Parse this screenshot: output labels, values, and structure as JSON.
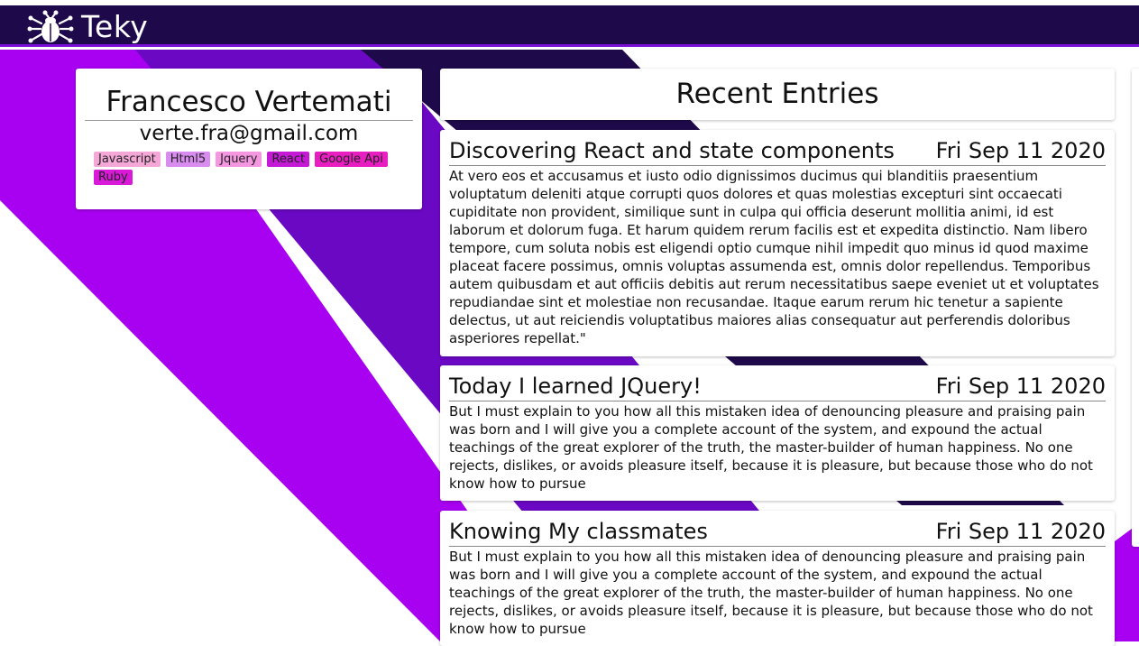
{
  "app": {
    "name": "Teky",
    "logo_icon": "bug-icon"
  },
  "profile": {
    "name": "Francesco Vertemati",
    "email": "verte.fra@gmail.com",
    "tags": [
      {
        "label": "Javascript",
        "color": "#f5a7d8"
      },
      {
        "label": "Html5",
        "color": "#d98cf0"
      },
      {
        "label": "Jquery",
        "color": "#f596e0"
      },
      {
        "label": "React",
        "color": "#c41ad6"
      },
      {
        "label": "Google Api",
        "color": "#e81ec0"
      },
      {
        "label": "Ruby",
        "color": "#d81ad8"
      }
    ]
  },
  "main": {
    "title": "Recent Entries",
    "entries": [
      {
        "title": "Discovering React and state components",
        "date": "Fri Sep 11 2020",
        "body": "At vero eos et accusamus et iusto odio dignissimos ducimus qui blanditiis praesentium voluptatum deleniti atque corrupti quos dolores et quas molestias excepturi sint occaecati cupiditate non provident, similique sunt in culpa qui officia deserunt mollitia animi, id est laborum et dolorum fuga. Et harum quidem rerum facilis est et expedita distinctio. Nam libero tempore, cum soluta nobis est eligendi optio cumque nihil impedit quo minus id quod maxime placeat facere possimus, omnis voluptas assumenda est, omnis dolor repellendus. Temporibus autem quibusdam et aut officiis debitis aut rerum necessitatibus saepe eveniet ut et voluptates repudiandae sint et molestiae non recusandae. Itaque earum rerum hic tenetur a sapiente delectus, ut aut reiciendis voluptatibus maiores alias consequatur aut perferendis doloribus asperiores repellat.\""
      },
      {
        "title": "Today I learned JQuery!",
        "date": "Fri Sep 11 2020",
        "body": "But I must explain to you how all this mistaken idea of denouncing pleasure and praising pain was born and I will give you a complete account of the system, and expound the actual teachings of the great explorer of the truth, the master-builder of human happiness. No one rejects, dislikes, or avoids pleasure itself, because it is pleasure, but because those who do not know how to pursue"
      },
      {
        "title": "Knowing My classmates",
        "date": "Fri Sep 11 2020",
        "body": "But I must explain to you how all this mistaken idea of denouncing pleasure and praising pain was born and I will give you a complete account of the system, and expound the actual teachings of the great explorer of the truth, the master-builder of human happiness. No one rejects, dislikes, or avoids pleasure itself, because it is pleasure, but because those who do not know how to pursue"
      }
    ]
  },
  "colors": {
    "topbar": "#1e0a4a",
    "accent": "#7a10d6",
    "bright_purple": "#a800f0",
    "dark_purple": "#6a08c4",
    "navy": "#1e0a4a"
  }
}
